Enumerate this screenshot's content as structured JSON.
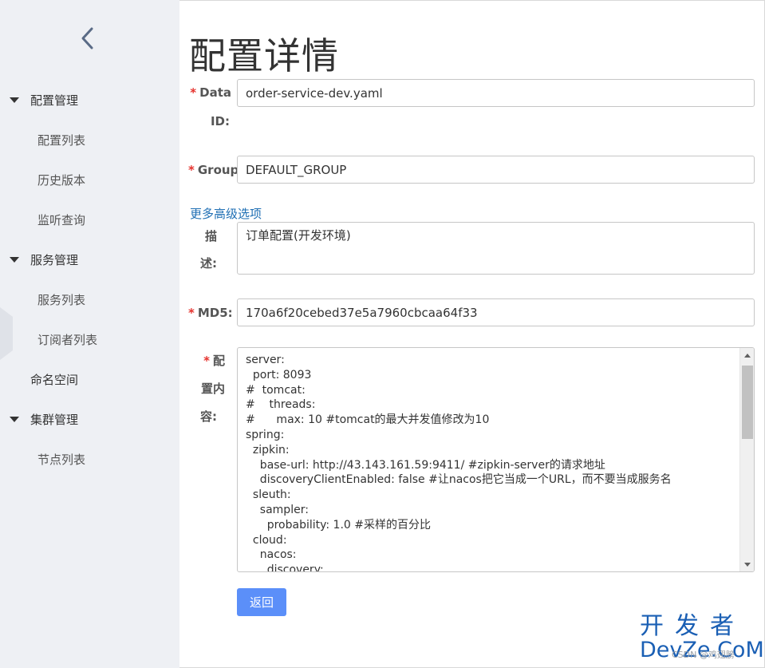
{
  "sidebar": {
    "groups": {
      "config": {
        "label": "配置管理",
        "items": [
          "配置列表",
          "历史版本",
          "监听查询"
        ]
      },
      "service": {
        "label": "服务管理",
        "items": [
          "服务列表",
          "订阅者列表"
        ]
      },
      "namespace": {
        "label": "命名空间"
      },
      "cluster": {
        "label": "集群管理",
        "items": [
          "节点列表"
        ]
      }
    }
  },
  "main": {
    "title": "配置详情",
    "fields": {
      "data_id": {
        "label_line1": "Data",
        "label_line2": "ID:",
        "value": "order-service-dev.yaml"
      },
      "group": {
        "label": "Group",
        "value": "DEFAULT_GROUP"
      },
      "advanced_link": "更多高级选项",
      "description": {
        "label_line1": "描",
        "label_line2": "述:",
        "value": "订单配置(开发环境)"
      },
      "md5": {
        "label": "MD5:",
        "value": "170a6f20cebed37e5a7960cbcaa64f33"
      },
      "content": {
        "label_line1": "配",
        "label_line2": "置内",
        "label_line3": "容:",
        "lines": [
          "server:",
          "  port: 8093",
          "#  tomcat:",
          "#    threads:",
          "#      max: 10 #tomcat的最大并发值修改为10",
          "spring:",
          "  zipkin:",
          "    base-url: http://43.143.161.59:9411/ #zipkin-server的请求地址",
          "    discoveryClientEnabled: false #让nacos把它当成一个URL，而不要当成服务名",
          "  sleuth:",
          "    sampler:",
          "      probability: 1.0 #采样的百分比",
          "  cloud:",
          "    nacos:",
          "      discovery:"
        ]
      }
    },
    "back_button": "返回",
    "required_mark": "*"
  },
  "watermark": {
    "top": "开发者",
    "bottom": "DevZe.CoM",
    "credit": "CSDN @鸡翅膀"
  },
  "colors": {
    "sidebar_bg": "#eef0f4",
    "primary": "#5b8ff9",
    "link": "#1f6fb4",
    "required": "#e5322d"
  }
}
